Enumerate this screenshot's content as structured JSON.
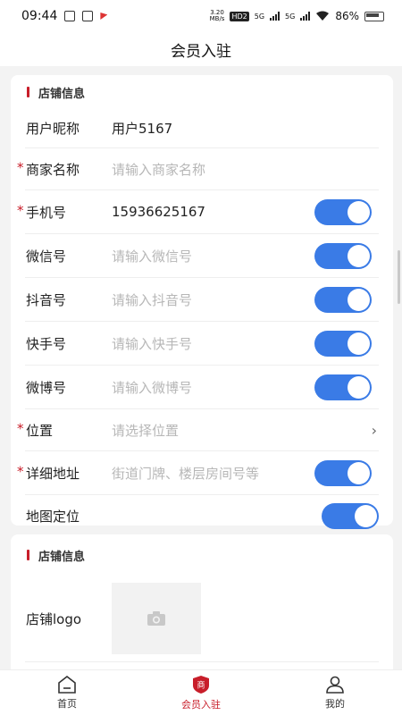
{
  "status_bar": {
    "time": "09:44",
    "net_speed": "3.20\nMB/s",
    "hd": "HD2",
    "net1": "5G",
    "net2": "5G",
    "battery": "86%"
  },
  "header": {
    "title": "会员入驻"
  },
  "shop_info": {
    "section_title": "店铺信息",
    "rows": [
      {
        "label": "用户昵称",
        "value": "用户5167"
      },
      {
        "label": "商家名称",
        "placeholder": "请输入商家名称"
      },
      {
        "label": "手机号",
        "value": "15936625167"
      },
      {
        "label": "微信号",
        "placeholder": "请输入微信号"
      },
      {
        "label": "抖音号",
        "placeholder": "请输入抖音号"
      },
      {
        "label": "快手号",
        "placeholder": "请输入快手号"
      },
      {
        "label": "微博号",
        "placeholder": "请输入微博号"
      },
      {
        "label": "位置",
        "placeholder": "请选择位置"
      },
      {
        "label": "详细地址",
        "placeholder": "街道门牌、楼层房间号等"
      },
      {
        "label": "地图定位"
      }
    ]
  },
  "shop_info2": {
    "section_title": "店铺信息",
    "logo_label": "店铺logo"
  },
  "tabbar": {
    "tabs": [
      {
        "label": "首页",
        "icon": "home-icon"
      },
      {
        "label": "会员入驻",
        "icon": "shop-badge-icon",
        "badge": "商"
      },
      {
        "label": "我的",
        "icon": "user-icon"
      }
    ],
    "active_color": "#c81e2a"
  },
  "colors": {
    "accent": "#c81e2a",
    "toggle_on": "#3a7be6"
  }
}
